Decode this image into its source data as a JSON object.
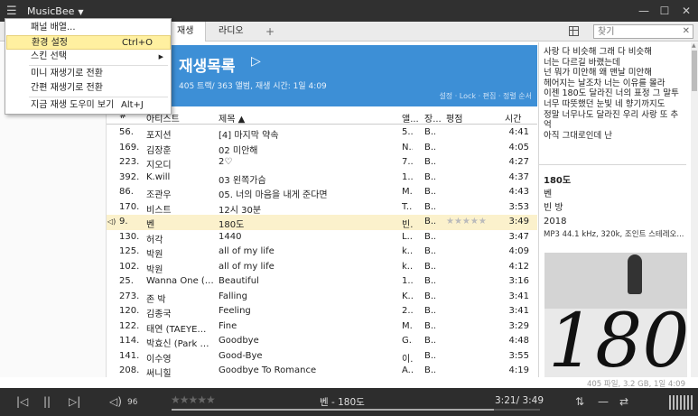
{
  "app": {
    "name": "MusicBee"
  },
  "tabs": [
    {
      "label": "재생",
      "active": true
    },
    {
      "label": "라디오",
      "active": false
    },
    {
      "label": "+",
      "active": false
    }
  ],
  "search": {
    "placeholder": "찾기"
  },
  "banner": {
    "title": "재생목록",
    "stats": "405 트랙/ 363 앨범, 재생 시간: 1일 4:09",
    "links": "설정 · Lock · 편집 · 정렬 순서"
  },
  "columns": {
    "num": "#",
    "artist": "아티스트",
    "title": "제목 ▲",
    "album": "앨...",
    "genre": "장...",
    "rating": "평점",
    "time": "시간"
  },
  "tracks": [
    {
      "num": "56.",
      "artist": "포지션",
      "title": "[4] 마지막 약속",
      "album": "5...",
      "genre": "B...",
      "rating": "",
      "time": "4:41"
    },
    {
      "num": "169.",
      "artist": "김장훈",
      "title": "02 미안해",
      "album": "N...",
      "genre": "B...",
      "rating": "",
      "time": "4:05"
    },
    {
      "num": "223.",
      "artist": "지오디",
      "title": "2♡",
      "album": "7...",
      "genre": "B...",
      "rating": "",
      "time": "4:27"
    },
    {
      "num": "392.",
      "artist": "K.will",
      "title": "03 왼쪽가슴",
      "album": "1...",
      "genre": "B...",
      "rating": "",
      "time": "4:37"
    },
    {
      "num": "86.",
      "artist": "조관우",
      "title": "05. 너의 마음을 내게 준다면",
      "album": "M...",
      "genre": "B...",
      "rating": "",
      "time": "4:43"
    },
    {
      "num": "170.",
      "artist": "비스트",
      "title": "12시 30분",
      "album": "T...",
      "genre": "B...",
      "rating": "",
      "time": "3:53"
    },
    {
      "num": "9.",
      "artist": "벤",
      "title": "180도",
      "album": "빈...",
      "genre": "B...",
      "rating": "★★★★★",
      "time": "3:49",
      "playing": true
    },
    {
      "num": "130.",
      "artist": "허각",
      "title": "1440",
      "album": "L...",
      "genre": "B...",
      "rating": "",
      "time": "3:47"
    },
    {
      "num": "125.",
      "artist": "박원",
      "title": "all of my life",
      "album": "k...",
      "genre": "B...",
      "rating": "",
      "time": "4:09"
    },
    {
      "num": "102.",
      "artist": "박원",
      "title": "all of my life",
      "album": "k...",
      "genre": "B...",
      "rating": "",
      "time": "4:12"
    },
    {
      "num": "25.",
      "artist": "Wanna One (…",
      "title": "Beautiful",
      "album": "1...",
      "genre": "B...",
      "rating": "",
      "time": "3:16"
    },
    {
      "num": "273.",
      "artist": "존 박",
      "title": "Falling",
      "album": "K...",
      "genre": "B...",
      "rating": "",
      "time": "3:41"
    },
    {
      "num": "120.",
      "artist": "김종국",
      "title": "Feeling",
      "album": "2...",
      "genre": "B...",
      "rating": "",
      "time": "3:41"
    },
    {
      "num": "122.",
      "artist": "태연 (TAEYE…",
      "title": "Fine",
      "album": "M...",
      "genre": "B...",
      "rating": "",
      "time": "3:29"
    },
    {
      "num": "114.",
      "artist": "박효신 (Park …",
      "title": "Goodbye",
      "album": "G...",
      "genre": "B...",
      "rating": "",
      "time": "4:48"
    },
    {
      "num": "141.",
      "artist": "이수영",
      "title": "Good-Bye",
      "album": "이...",
      "genre": "B...",
      "rating": "",
      "time": "3:55"
    },
    {
      "num": "208.",
      "artist": "써니힐",
      "title": "Goodbye To Romance",
      "album": "A...",
      "genre": "B...",
      "rating": "",
      "time": "4:19"
    }
  ],
  "lyrics": "사랑 다 비슷해 그래 다 비슷해\n너는 다르길 바랬는데\n넌 뭐가 미안해 왜 맨날 미안해\n헤어지는 날조차 너는 이유를 몰라\n이젠 180도 달라진 너의 표정 그 말투\n너무 따뜻했던 눈빛 네 향기까지도\n정말 너무나도 달라진 우리 사랑 또 추억\n아직 그대로인데 난",
  "nowinfo": {
    "title": "180도",
    "artist": "벤",
    "album": "빈 방",
    "year": "2018",
    "format": "MP3 44.1 kHz, 320k, 조인트 스테레오..."
  },
  "cover_text": "180°",
  "status": "405 파일, 3.2 GB, 1일 4:09",
  "player": {
    "volume": "96",
    "stars": "★★★★★",
    "now_playing": "벤 - 180도",
    "time": "3:21/ 3:49",
    "progress": 0.876
  },
  "menu": [
    {
      "label": "패널 배열...",
      "shortcut": "",
      "arrow": false
    },
    {
      "label": "환경 설정",
      "shortcut": "Ctrl+O",
      "arrow": false,
      "highlighted": true
    },
    {
      "label": "스킨 선택",
      "shortcut": "",
      "arrow": true
    },
    {
      "label": "미니 재생기로 전환",
      "shortcut": "",
      "arrow": false
    },
    {
      "label": "간편 재생기로 전환",
      "shortcut": "",
      "arrow": false
    },
    {
      "label": "지금 재생 도우미 보기",
      "shortcut": "Alt+J",
      "arrow": false
    }
  ]
}
